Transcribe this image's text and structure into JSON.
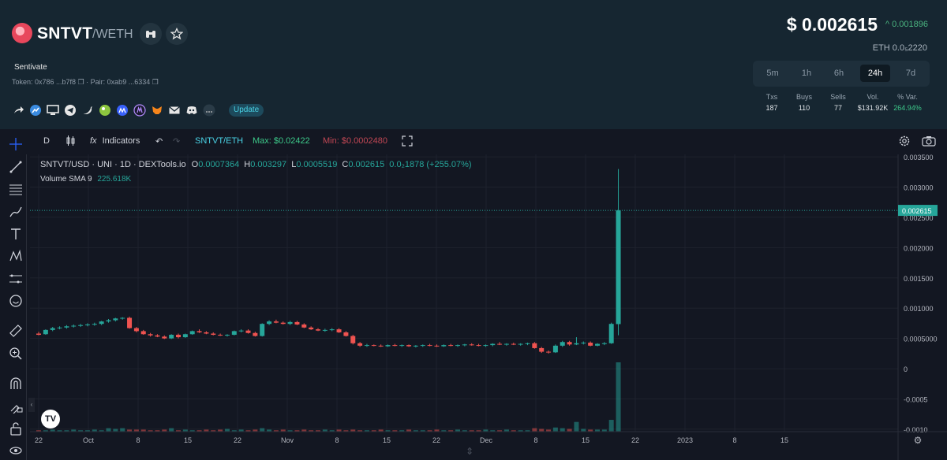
{
  "header": {
    "symbol": "SNTVT",
    "quote": "/WETH",
    "token_name": "Sentivate",
    "token_line": "Token: 0x786 ...b7f8",
    "pair_line": "· Pair: 0xab9 ...6334",
    "update_label": "Update",
    "social_icons": [
      "share-icon",
      "chart-site-icon",
      "website-icon",
      "telegram-icon",
      "twitter-icon",
      "coingecko-icon",
      "coinmarketcap-icon",
      "cmc-alt-icon",
      "metamask-icon",
      "email-icon",
      "discord-icon",
      "more-icon"
    ]
  },
  "price": {
    "usd": "$ 0.002615",
    "change": "^ 0.001896",
    "eth": "ETH  0.0₅2220"
  },
  "timeframes": {
    "items": [
      "5m",
      "1h",
      "6h",
      "24h",
      "7d"
    ],
    "active": "24h"
  },
  "stats": {
    "headers": [
      "Txs",
      "Buys",
      "Sells",
      "Vol.",
      "% Var."
    ],
    "values": [
      "187",
      "110",
      "77",
      "$131.92K",
      "264.94%"
    ]
  },
  "toolbar": {
    "interval": "D",
    "indicators_label": "Indicators",
    "pair_label": "SNTVT/ETH",
    "max_label": "Max: $0.02422",
    "min_label": "Min: $0.0002480"
  },
  "legend": {
    "title": "SNTVT/USD · UNI · 1D · DEXTools.io",
    "o_label": "O",
    "o_value": "0.0007364",
    "h_label": "H",
    "h_value": "0.003297",
    "l_label": "L",
    "l_value": "0.0005519",
    "c_label": "C",
    "c_value": "0.002615",
    "change": "0.0₂1878 (+255.07%)",
    "volume_label": "Volume SMA 9",
    "volume_value": "225.618K"
  },
  "tv_logo": "TV",
  "colors": {
    "up": "#26a69a",
    "down": "#ef5350",
    "header_bg": "#162631",
    "chart_bg": "#131722",
    "price_line": "#26a69a"
  },
  "chart_data": {
    "type": "candlestick",
    "symbol": "SNTVT/USD",
    "x_tick_labels": [
      "22",
      "Oct",
      "8",
      "15",
      "22",
      "Nov",
      "8",
      "15",
      "22",
      "Dec",
      "8",
      "15",
      "22",
      "2023",
      "8",
      "15"
    ],
    "y_tick_labels": [
      "0.003500",
      "0.003000",
      "0.002500",
      "0.002000",
      "0.001500",
      "0.001000",
      "0.0005000",
      "0",
      "-0.0005",
      "-0.0010"
    ],
    "ylim": [
      -0.00104,
      0.00354
    ],
    "last_price": "0.002615",
    "last_price_value": 0.002615,
    "candles": [
      {
        "o": 0.00058,
        "h": 0.00061,
        "l": 0.00055,
        "c": 0.00056
      },
      {
        "o": 0.00057,
        "h": 0.00065,
        "l": 0.00056,
        "c": 0.00064
      },
      {
        "o": 0.00064,
        "h": 0.00069,
        "l": 0.00062,
        "c": 0.00067
      },
      {
        "o": 0.00067,
        "h": 0.0007,
        "l": 0.00065,
        "c": 0.00068
      },
      {
        "o": 0.00068,
        "h": 0.00072,
        "l": 0.00066,
        "c": 0.0007
      },
      {
        "o": 0.0007,
        "h": 0.00073,
        "l": 0.00068,
        "c": 0.00071
      },
      {
        "o": 0.00071,
        "h": 0.00074,
        "l": 0.00069,
        "c": 0.00072
      },
      {
        "o": 0.00072,
        "h": 0.00075,
        "l": 0.0007,
        "c": 0.00073
      },
      {
        "o": 0.00073,
        "h": 0.00076,
        "l": 0.00071,
        "c": 0.00074
      },
      {
        "o": 0.00074,
        "h": 0.00079,
        "l": 0.00072,
        "c": 0.00078
      },
      {
        "o": 0.00078,
        "h": 0.00082,
        "l": 0.00076,
        "c": 0.0008
      },
      {
        "o": 0.0008,
        "h": 0.00084,
        "l": 0.00078,
        "c": 0.00083
      },
      {
        "o": 0.00083,
        "h": 0.00085,
        "l": 0.00081,
        "c": 0.00084
      },
      {
        "o": 0.00084,
        "h": 0.00086,
        "l": 0.00066,
        "c": 0.00067
      },
      {
        "o": 0.00067,
        "h": 0.00069,
        "l": 0.0006,
        "c": 0.00062
      },
      {
        "o": 0.00062,
        "h": 0.00064,
        "l": 0.00056,
        "c": 0.00057
      },
      {
        "o": 0.00057,
        "h": 0.00059,
        "l": 0.00053,
        "c": 0.00055
      },
      {
        "o": 0.00055,
        "h": 0.00057,
        "l": 0.00052,
        "c": 0.00053
      },
      {
        "o": 0.00053,
        "h": 0.00055,
        "l": 0.00049,
        "c": 0.0005
      },
      {
        "o": 0.0005,
        "h": 0.00057,
        "l": 0.00049,
        "c": 0.00056
      },
      {
        "o": 0.00056,
        "h": 0.00058,
        "l": 0.0005,
        "c": 0.00052
      },
      {
        "o": 0.00052,
        "h": 0.00058,
        "l": 0.00051,
        "c": 0.00057
      },
      {
        "o": 0.00057,
        "h": 0.00063,
        "l": 0.00056,
        "c": 0.00062
      },
      {
        "o": 0.00062,
        "h": 0.00065,
        "l": 0.00059,
        "c": 0.0006
      },
      {
        "o": 0.0006,
        "h": 0.00062,
        "l": 0.00057,
        "c": 0.00058
      },
      {
        "o": 0.00058,
        "h": 0.0006,
        "l": 0.00055,
        "c": 0.00056
      },
      {
        "o": 0.00056,
        "h": 0.00058,
        "l": 0.00054,
        "c": 0.00055
      },
      {
        "o": 0.00055,
        "h": 0.00057,
        "l": 0.00053,
        "c": 0.00056
      },
      {
        "o": 0.00056,
        "h": 0.00063,
        "l": 0.00055,
        "c": 0.00062
      },
      {
        "o": 0.00062,
        "h": 0.00065,
        "l": 0.0006,
        "c": 0.00063
      },
      {
        "o": 0.00063,
        "h": 0.00065,
        "l": 0.00058,
        "c": 0.00059
      },
      {
        "o": 0.00059,
        "h": 0.00061,
        "l": 0.00053,
        "c": 0.00054
      },
      {
        "o": 0.00054,
        "h": 0.00075,
        "l": 0.00053,
        "c": 0.00074
      },
      {
        "o": 0.00074,
        "h": 0.0008,
        "l": 0.00072,
        "c": 0.00078
      },
      {
        "o": 0.00078,
        "h": 0.00081,
        "l": 0.00075,
        "c": 0.00076
      },
      {
        "o": 0.00076,
        "h": 0.00078,
        "l": 0.00073,
        "c": 0.00074
      },
      {
        "o": 0.00074,
        "h": 0.00079,
        "l": 0.00072,
        "c": 0.00077
      },
      {
        "o": 0.00077,
        "h": 0.00079,
        "l": 0.00072,
        "c": 0.00073
      },
      {
        "o": 0.00073,
        "h": 0.00075,
        "l": 0.00067,
        "c": 0.00068
      },
      {
        "o": 0.00068,
        "h": 0.0007,
        "l": 0.00064,
        "c": 0.00065
      },
      {
        "o": 0.00065,
        "h": 0.00067,
        "l": 0.00062,
        "c": 0.00063
      },
      {
        "o": 0.00063,
        "h": 0.00066,
        "l": 0.00061,
        "c": 0.00064
      },
      {
        "o": 0.00064,
        "h": 0.00067,
        "l": 0.00062,
        "c": 0.00065
      },
      {
        "o": 0.00065,
        "h": 0.00067,
        "l": 0.00059,
        "c": 0.0006
      },
      {
        "o": 0.0006,
        "h": 0.00062,
        "l": 0.00053,
        "c": 0.00054
      },
      {
        "o": 0.00054,
        "h": 0.00056,
        "l": 0.0004,
        "c": 0.00042
      },
      {
        "o": 0.00042,
        "h": 0.00044,
        "l": 0.00036,
        "c": 0.00038
      },
      {
        "o": 0.00038,
        "h": 0.00041,
        "l": 0.00036,
        "c": 0.00039
      },
      {
        "o": 0.00039,
        "h": 0.0004,
        "l": 0.00037,
        "c": 0.00038
      },
      {
        "o": 0.00038,
        "h": 0.0004,
        "l": 0.00036,
        "c": 0.00037
      },
      {
        "o": 0.00037,
        "h": 0.0004,
        "l": 0.00036,
        "c": 0.00039
      },
      {
        "o": 0.00039,
        "h": 0.00041,
        "l": 0.00037,
        "c": 0.00038
      },
      {
        "o": 0.00038,
        "h": 0.0004,
        "l": 0.00036,
        "c": 0.00039
      },
      {
        "o": 0.00039,
        "h": 0.0004,
        "l": 0.00036,
        "c": 0.00037
      },
      {
        "o": 0.00037,
        "h": 0.00039,
        "l": 0.00035,
        "c": 0.00038
      },
      {
        "o": 0.00038,
        "h": 0.0004,
        "l": 0.00036,
        "c": 0.00039
      },
      {
        "o": 0.00039,
        "h": 0.00041,
        "l": 0.00037,
        "c": 0.00038
      },
      {
        "o": 0.00038,
        "h": 0.0004,
        "l": 0.00036,
        "c": 0.00037
      },
      {
        "o": 0.00037,
        "h": 0.0004,
        "l": 0.00036,
        "c": 0.00039
      },
      {
        "o": 0.00039,
        "h": 0.00041,
        "l": 0.00037,
        "c": 0.00038
      },
      {
        "o": 0.00038,
        "h": 0.0004,
        "l": 0.00036,
        "c": 0.00039
      },
      {
        "o": 0.00039,
        "h": 0.00041,
        "l": 0.00037,
        "c": 0.0004
      },
      {
        "o": 0.0004,
        "h": 0.00042,
        "l": 0.00038,
        "c": 0.00039
      },
      {
        "o": 0.00039,
        "h": 0.00041,
        "l": 0.00037,
        "c": 0.00038
      },
      {
        "o": 0.00038,
        "h": 0.0004,
        "l": 0.00036,
        "c": 0.00039
      },
      {
        "o": 0.00039,
        "h": 0.00042,
        "l": 0.00037,
        "c": 0.00041
      },
      {
        "o": 0.00041,
        "h": 0.00044,
        "l": 0.00039,
        "c": 0.0004
      },
      {
        "o": 0.0004,
        "h": 0.00042,
        "l": 0.00038,
        "c": 0.00041
      },
      {
        "o": 0.00041,
        "h": 0.00043,
        "l": 0.00039,
        "c": 0.0004
      },
      {
        "o": 0.0004,
        "h": 0.00042,
        "l": 0.00038,
        "c": 0.00041
      },
      {
        "o": 0.00041,
        "h": 0.00043,
        "l": 0.00039,
        "c": 0.00042
      },
      {
        "o": 0.00042,
        "h": 0.00044,
        "l": 0.00033,
        "c": 0.00034
      },
      {
        "o": 0.00034,
        "h": 0.00036,
        "l": 0.00026,
        "c": 0.00028
      },
      {
        "o": 0.00028,
        "h": 0.0003,
        "l": 0.00025,
        "c": 0.00027
      },
      {
        "o": 0.00027,
        "h": 0.0004,
        "l": 0.00026,
        "c": 0.00038
      },
      {
        "o": 0.00038,
        "h": 0.00046,
        "l": 0.00036,
        "c": 0.00044
      },
      {
        "o": 0.00044,
        "h": 0.00046,
        "l": 0.00038,
        "c": 0.0004
      },
      {
        "o": 0.0004,
        "h": 0.00052,
        "l": 0.00039,
        "c": 0.00042
      },
      {
        "o": 0.00042,
        "h": 0.00045,
        "l": 0.0004,
        "c": 0.00043
      },
      {
        "o": 0.00043,
        "h": 0.00045,
        "l": 0.00037,
        "c": 0.00038
      },
      {
        "o": 0.00038,
        "h": 0.00042,
        "l": 0.00037,
        "c": 0.00041
      },
      {
        "o": 0.00041,
        "h": 0.00044,
        "l": 0.00039,
        "c": 0.00042
      },
      {
        "o": 0.00042,
        "h": 0.00076,
        "l": 0.00041,
        "c": 0.00074
      },
      {
        "o": 0.0007364,
        "h": 0.003297,
        "l": 0.0005519,
        "c": 0.002615
      }
    ],
    "volumes": [
      0.02,
      0.02,
      0.03,
      0.02,
      0.02,
      0.03,
      0.02,
      0.02,
      0.03,
      0.02,
      0.05,
      0.04,
      0.05,
      0.03,
      0.03,
      0.03,
      0.02,
      0.02,
      0.03,
      0.05,
      0.02,
      0.03,
      0.02,
      0.02,
      0.03,
      0.02,
      0.03,
      0.04,
      0.02,
      0.03,
      0.02,
      0.03,
      0.05,
      0.03,
      0.02,
      0.03,
      0.02,
      0.02,
      0.03,
      0.02,
      0.02,
      0.03,
      0.02,
      0.03,
      0.02,
      0.03,
      0.02,
      0.02,
      0.02,
      0.03,
      0.02,
      0.02,
      0.02,
      0.03,
      0.02,
      0.02,
      0.02,
      0.03,
      0.02,
      0.02,
      0.03,
      0.02,
      0.02,
      0.02,
      0.03,
      0.02,
      0.02,
      0.03,
      0.02,
      0.02,
      0.02,
      0.05,
      0.04,
      0.03,
      0.06,
      0.05,
      0.04,
      0.14,
      0.04,
      0.03,
      0.03,
      0.03,
      0.17,
      1.0
    ]
  }
}
